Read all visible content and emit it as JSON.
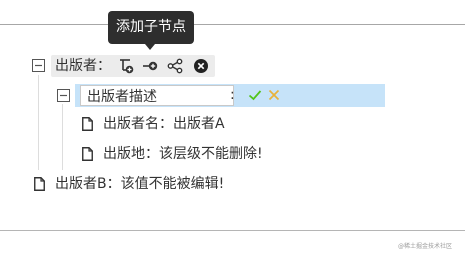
{
  "tooltip": {
    "text": "添加子节点"
  },
  "tree": {
    "root": {
      "label": "出版者："
    },
    "editing": {
      "input_value": "出版者描述",
      "separator": ":"
    },
    "children": [
      {
        "label": "出版者名：出版者A"
      },
      {
        "label": "出版地：该层级不能删除!"
      }
    ],
    "sibling": {
      "label": "出版者B：该值不能被编辑!"
    }
  },
  "actions": [
    {
      "icon": "add-child-icon"
    },
    {
      "icon": "add-sibling-icon"
    },
    {
      "icon": "share-icon"
    },
    {
      "icon": "delete-icon"
    }
  ],
  "colors": {
    "editing_highlight": "#c6e3f9",
    "confirm": "#52c41a",
    "cancel": "#e8b23a",
    "tooltip_bg": "#2e2e2e"
  },
  "watermark": {
    "text": "@稀土掘金技术社区"
  }
}
